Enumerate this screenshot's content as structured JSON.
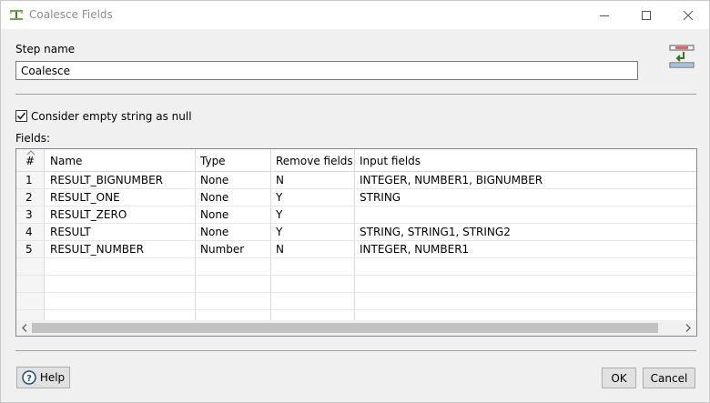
{
  "window": {
    "title": "Coalesce Fields"
  },
  "step": {
    "label": "Step name",
    "value": "Coalesce"
  },
  "options": {
    "empty_as_null_label": "Consider empty string as null",
    "empty_as_null_checked": true
  },
  "fields": {
    "label": "Fields:",
    "columns": [
      "#",
      "Name",
      "Type",
      "Remove fields",
      "Input fields"
    ],
    "rows": [
      {
        "num": "1",
        "name": "RESULT_BIGNUMBER",
        "type": "None",
        "remove": "N",
        "inputs": "INTEGER, NUMBER1, BIGNUMBER"
      },
      {
        "num": "2",
        "name": "RESULT_ONE",
        "type": "None",
        "remove": "Y",
        "inputs": "STRING"
      },
      {
        "num": "3",
        "name": "RESULT_ZERO",
        "type": "None",
        "remove": "Y",
        "inputs": ""
      },
      {
        "num": "4",
        "name": "RESULT",
        "type": "None",
        "remove": "Y",
        "inputs": "STRING, STRING1, STRING2"
      },
      {
        "num": "5",
        "name": "RESULT_NUMBER",
        "type": "Number",
        "remove": "N",
        "inputs": "INTEGER, NUMBER1"
      }
    ]
  },
  "buttons": {
    "help": "Help",
    "ok": "OK",
    "cancel": "Cancel"
  }
}
